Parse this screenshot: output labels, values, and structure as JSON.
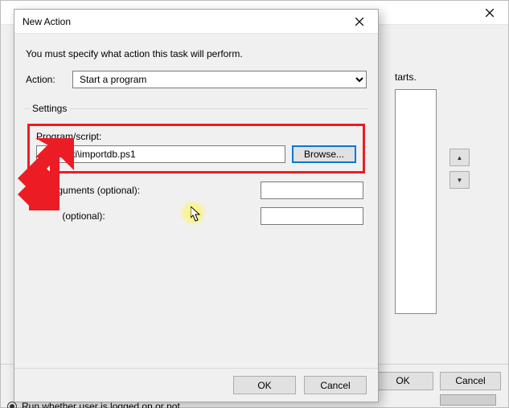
{
  "bg": {
    "starts": "tarts.",
    "ok_label": "OK",
    "cancel_label": "Cancel",
    "bottom_radio_text": "Run whether user is logged on or not"
  },
  "dialog": {
    "title": "New Action",
    "instruction": "You must specify what action this task will perform.",
    "action_label": "Action:",
    "action_value": "Start a program",
    "settings_legend": "Settings",
    "program_label": "Program/script:",
    "program_value": "C:\\Ozeki\\importdb.ps1",
    "browse_label": "Browse...",
    "args_label": "Add arguments (optional):",
    "args_value": "",
    "startin_label": "Start in (optional):",
    "startin_label_visible": "(optional):",
    "startin_value": "",
    "ok_label": "OK",
    "cancel_label": "Cancel"
  },
  "annotations": {
    "arrow_color": "#ec1c24",
    "highlight_color": "#fff65a"
  }
}
